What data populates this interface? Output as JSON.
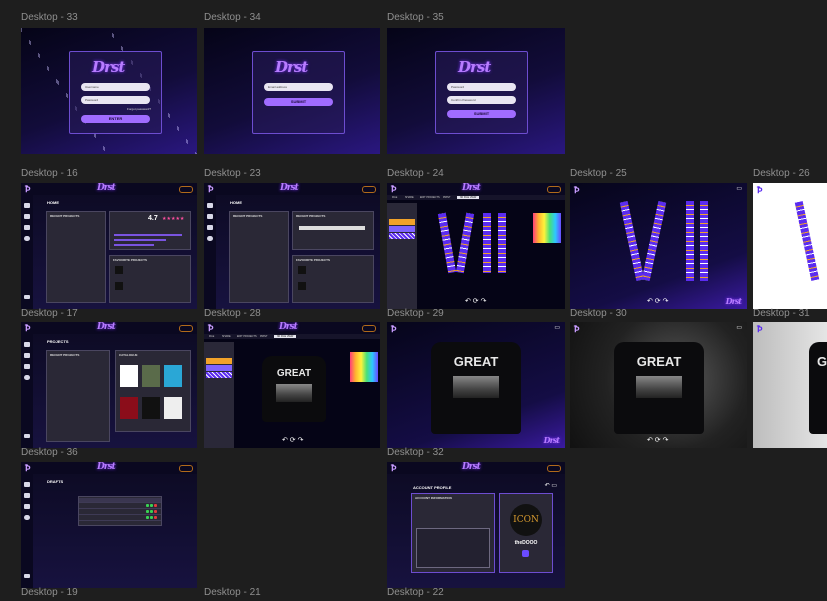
{
  "canvas": {
    "background": "#1e1e1e",
    "label_color": "#8f8f8f",
    "accent": "#a06cff"
  },
  "frame_labels": {
    "d33": "Desktop - 33",
    "d34": "Desktop - 34",
    "d35": "Desktop - 35",
    "d16": "Desktop - 16",
    "d23": "Desktop - 23",
    "d24": "Desktop - 24",
    "d25": "Desktop - 25",
    "d26": "Desktop - 26",
    "d17": "Desktop - 17",
    "d28": "Desktop - 28",
    "d29": "Desktop - 29",
    "d30": "Desktop - 30",
    "d31": "Desktop - 31",
    "d36": "Desktop - 36",
    "d32": "Desktop - 32",
    "d19": "Desktop - 19",
    "d21": "Desktop - 21",
    "d22": "Desktop - 22"
  },
  "brand": {
    "logo_text": "Drst",
    "logo_mark": "Ꝥ"
  },
  "login": {
    "username_placeholder": "Username",
    "password_placeholder": "Password",
    "forgot": "Forgot password?",
    "enter_button": "ENTER",
    "email_placeholder": "Email address",
    "submit_button": "SUBMIT",
    "new_password_placeholder": "Password",
    "confirm_password_placeholder": "Confirm Password"
  },
  "app": {
    "home_title": "HOME",
    "projects_title": "PROJECTS",
    "drafts_title": "DRAFTS",
    "account_title": "ACCOUNT PROFILE",
    "recent_projects": "RECENT PROJECTS",
    "rating": "4.7",
    "rating_stars": "★★★★★",
    "favourite_projects": "FAVOURITE PROJECTS",
    "catalogue": "CATALOGUE",
    "account_info": "ACCOUNT INFORMATION",
    "account_name": "theDOOO",
    "account_brand": "ICON",
    "great_text": "GREAT",
    "tabs": [
      "FILE",
      "SHARE",
      "EDIT PROJECTS",
      "PRINT"
    ],
    "active_tab": "3D FILE VIEW"
  },
  "icons": {
    "nav": [
      "home-icon",
      "cube-icon",
      "folder-icon",
      "settings-icon",
      "logout-icon"
    ],
    "toolbar": [
      "undo-icon",
      "rotate-icon",
      "redo-icon"
    ]
  },
  "colors": {
    "lanyard_purple": "#5b2cf0",
    "lanyard_orange": "#f1a22a",
    "login_button": "#a06cff",
    "status_green": "#39d353",
    "status_red": "#e03c3c",
    "coin_orange": "#b06a1a"
  }
}
